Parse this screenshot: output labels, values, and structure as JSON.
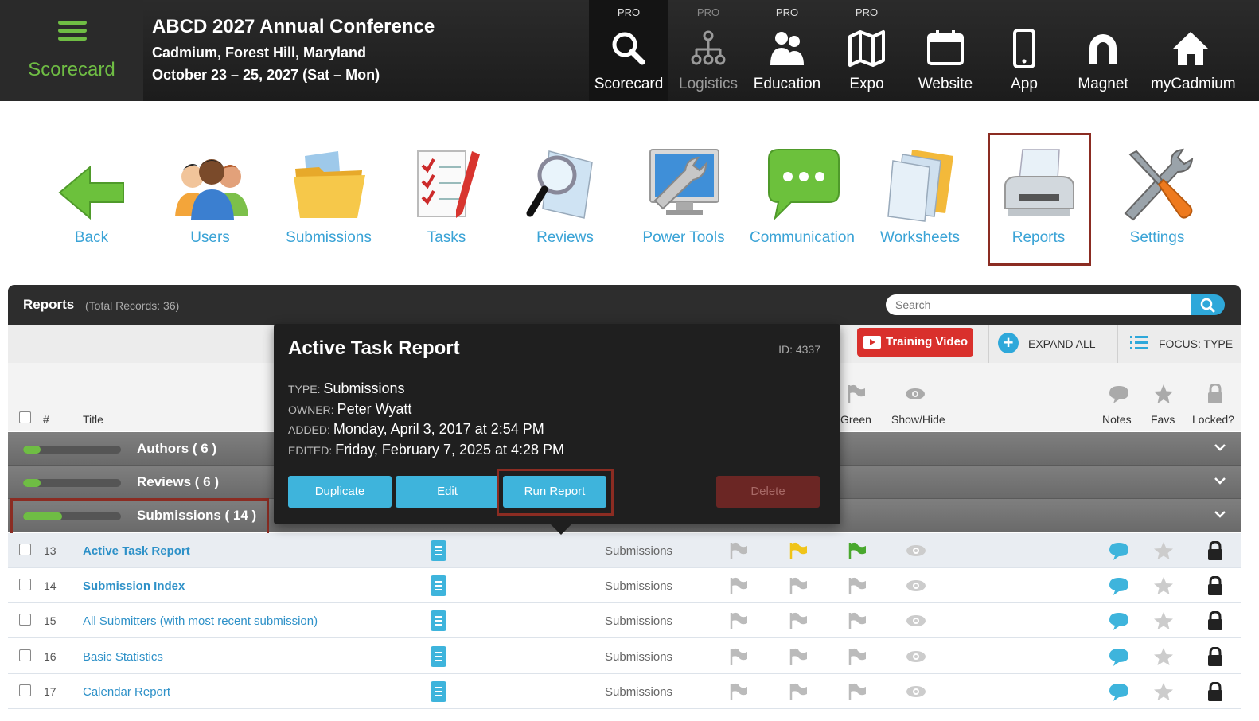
{
  "header": {
    "brand_label": "Scorecard",
    "conference_title": "ABCD 2027 Annual Conference",
    "conference_location": "Cadmium, Forest Hill, Maryland",
    "conference_dates": "October 23 – 25, 2027 (Sat – Mon)",
    "nav": [
      {
        "label": "Scorecard",
        "badge": "PRO",
        "icon": "search-icon"
      },
      {
        "label": "Logistics",
        "badge": "PRO",
        "icon": "org-chart-icon"
      },
      {
        "label": "Education",
        "badge": "PRO",
        "icon": "people-icon"
      },
      {
        "label": "Expo",
        "badge": "PRO",
        "icon": "map-icon"
      },
      {
        "label": "Website",
        "badge": "",
        "icon": "browser-icon"
      },
      {
        "label": "App",
        "badge": "",
        "icon": "phone-icon"
      },
      {
        "label": "Magnet",
        "badge": "",
        "icon": "magnet-icon"
      },
      {
        "label": "myCadmium",
        "badge": "",
        "icon": "home-icon"
      }
    ]
  },
  "toolbar": {
    "items": [
      {
        "label": "Back",
        "icon": "back-arrow-icon"
      },
      {
        "label": "Users",
        "icon": "users-icon"
      },
      {
        "label": "Submissions",
        "icon": "folder-icon"
      },
      {
        "label": "Tasks",
        "icon": "checklist-icon"
      },
      {
        "label": "Reviews",
        "icon": "magnifier-icon"
      },
      {
        "label": "Power Tools",
        "icon": "monitor-wrench-icon"
      },
      {
        "label": "Communication",
        "icon": "chat-bubble-icon"
      },
      {
        "label": "Worksheets",
        "icon": "worksheets-icon"
      },
      {
        "label": "Reports",
        "icon": "printer-icon"
      },
      {
        "label": "Settings",
        "icon": "tools-icon"
      }
    ]
  },
  "panel": {
    "title": "Reports",
    "total_records": "(Total Records: 36)",
    "search_placeholder": "Search",
    "training_video_label": "Training Video",
    "expand_all_label": "EXPAND ALL",
    "focus_type_label": "FOCUS: TYPE",
    "columns": {
      "number": "#",
      "title": "Title",
      "green": "Green",
      "show_hide": "Show/Hide",
      "notes": "Notes",
      "favs": "Favs",
      "locked": "Locked?"
    },
    "groups": [
      {
        "label": "Authors ( 6 )",
        "progress": 0.18
      },
      {
        "label": "Reviews ( 6 )",
        "progress": 0.18
      },
      {
        "label": "Submissions ( 14 )",
        "progress": 0.4
      }
    ],
    "rows": [
      {
        "num": "13",
        "title": "Active Task Report",
        "type": "Submissions"
      },
      {
        "num": "14",
        "title": "Submission Index",
        "type": "Submissions"
      },
      {
        "num": "15",
        "title": "All Submitters (with most recent submission)",
        "type": "Submissions"
      },
      {
        "num": "16",
        "title": "Basic Statistics",
        "type": "Submissions"
      },
      {
        "num": "17",
        "title": "Calendar Report",
        "type": "Submissions"
      }
    ]
  },
  "popover": {
    "title": "Active Task Report",
    "id": "ID: 4337",
    "type_key": "TYPE:",
    "type_value": "Submissions",
    "owner_key": "OWNER:",
    "owner_value": "Peter Wyatt",
    "added_key": "ADDED:",
    "added_value": "Monday, April 3, 2017 at 2:54 PM",
    "edited_key": "EDITED:",
    "edited_value": "Friday, February 7, 2025 at 4:28 PM",
    "buttons": {
      "duplicate": "Duplicate",
      "edit": "Edit",
      "run_report": "Run Report",
      "delete": "Delete"
    }
  },
  "colors": {
    "accent_blue": "#2ea8da",
    "brand_green": "#6fbd44",
    "highlight_red": "#8b2c22",
    "training_red": "#d9302c"
  }
}
